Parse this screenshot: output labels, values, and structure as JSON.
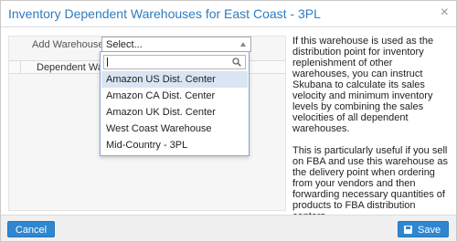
{
  "dialog": {
    "title": "Inventory Dependent Warehouses for East Coast - 3PL",
    "close_glyph": "×"
  },
  "form": {
    "add_label": "Add Warehouse:",
    "select_value": "Select...",
    "table_column": "Dependent Warehouse"
  },
  "dropdown": {
    "search_value": "",
    "options": [
      "Amazon US Dist. Center",
      "Amazon CA Dist. Center",
      "Amazon UK Dist. Center",
      "West Coast Warehouse",
      "Mid-Country - 3PL"
    ],
    "highlighted_index": 0
  },
  "help": {
    "paragraph1": "If this warehouse is used as the distribution point for inventory replenishment of other warehouses, you can instruct Skubana to calculate its sales velocity and minimum inventory levels by combining the sales velocities of all dependent warehouses.",
    "paragraph2": "This is particularly useful if you sell on FBA and use this warehouse as the delivery point when ordering from your vendors and then forwarding necessary quantities of products to FBA distribution centers."
  },
  "footer": {
    "cancel_label": "Cancel",
    "save_label": "Save"
  },
  "colors": {
    "accent": "#2f87d0",
    "title": "#2f7bbf",
    "highlight": "#d9e5f3"
  },
  "icons": [
    "close-icon",
    "caret-up-icon",
    "search-icon",
    "save-icon"
  ]
}
